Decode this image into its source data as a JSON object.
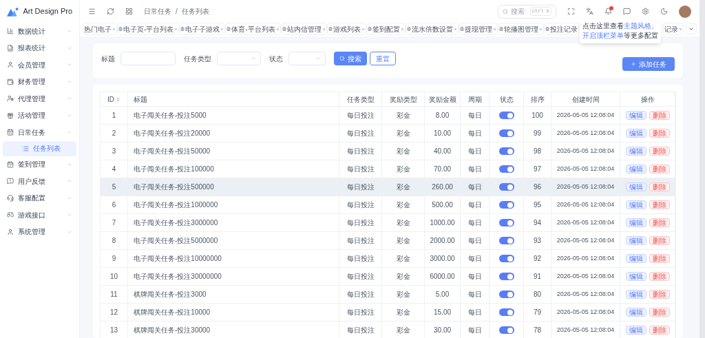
{
  "brand": {
    "name": "Art Design Pro"
  },
  "sidebar": {
    "items": [
      {
        "label": "数据统计",
        "expanded": false
      },
      {
        "label": "报表统计",
        "expanded": false
      },
      {
        "label": "会员管理",
        "expanded": false
      },
      {
        "label": "财务管理",
        "expanded": false
      },
      {
        "label": "代理管理",
        "expanded": false
      },
      {
        "label": "活动管理",
        "expanded": false
      },
      {
        "label": "日常任务",
        "expanded": true,
        "children": [
          {
            "label": "任务列表",
            "selected": true
          }
        ]
      },
      {
        "label": "签到管理",
        "expanded": false
      },
      {
        "label": "用户反馈",
        "expanded": false
      },
      {
        "label": "客服配置",
        "expanded": false
      },
      {
        "label": "游戏接口",
        "expanded": false
      },
      {
        "label": "系统管理",
        "expanded": false
      }
    ]
  },
  "breadcrumb": {
    "items": [
      "日常任务",
      "任务列表"
    ],
    "separator": "/"
  },
  "search": {
    "placeholder": "搜索",
    "shortcut": "ctrl k"
  },
  "notifications": {
    "unread": true
  },
  "tabs": [
    {
      "label": "热门电子"
    },
    {
      "label": "电子页-平台列表"
    },
    {
      "label": "电子子游戏"
    },
    {
      "label": "体育-平台列表"
    },
    {
      "label": "站内信管理"
    },
    {
      "label": "游戏列表"
    },
    {
      "label": "签到配置"
    },
    {
      "label": "流水倍数设置"
    },
    {
      "label": "提现管理"
    },
    {
      "label": "轮播图管理"
    },
    {
      "label": "投注记录"
    },
    {
      "label": "记录"
    }
  ],
  "tooltip": {
    "lines": [
      [
        {
          "text": "点击这里查看",
          "link": false
        },
        {
          "text": "主题风格",
          "link": true
        },
        {
          "text": "、",
          "link": false
        }
      ],
      [
        {
          "text": "开启顶栏菜单",
          "link": true
        },
        {
          "text": "等更多配置",
          "link": false
        }
      ]
    ]
  },
  "filters": [
    {
      "label": "标题",
      "kind": "input"
    },
    {
      "label": "任务类型",
      "kind": "select"
    },
    {
      "label": "状态",
      "kind": "select"
    }
  ],
  "search_button": "搜索",
  "reset_button": "重置",
  "add_button": "添加任务",
  "table": {
    "columns": [
      "ID",
      "标题",
      "任务类型",
      "奖励类型",
      "奖励金额",
      "周期",
      "状态",
      "排序",
      "创建时间",
      "操作"
    ],
    "rows": [
      {
        "id": "1",
        "title": "电子闯关任务-投注5000",
        "type": "每日投注",
        "reward_type": "彩金",
        "amount": "8.00",
        "period": "每日",
        "on": true,
        "sort": "100",
        "created": "2026-05-05 12:08:04",
        "hovered": false,
        "actions": [
          "编辑",
          "删除"
        ]
      },
      {
        "id": "2",
        "title": "电子闯关任务-投注20000",
        "type": "每日投注",
        "reward_type": "彩金",
        "amount": "10.00",
        "period": "每日",
        "on": true,
        "sort": "99",
        "created": "2026-05-05 12:08:04",
        "hovered": false,
        "actions": [
          "编辑",
          "删除"
        ]
      },
      {
        "id": "3",
        "title": "电子闯关任务-投注50000",
        "type": "每日投注",
        "reward_type": "彩金",
        "amount": "40.00",
        "period": "每日",
        "on": true,
        "sort": "98",
        "created": "2026-05-05 12:08:04",
        "hovered": false,
        "actions": [
          "编辑",
          "删除"
        ]
      },
      {
        "id": "4",
        "title": "电子闯关任务-投注100000",
        "type": "每日投注",
        "reward_type": "彩金",
        "amount": "70.00",
        "period": "每日",
        "on": true,
        "sort": "97",
        "created": "2026-05-05 12:08:04",
        "hovered": false,
        "actions": [
          "编辑",
          "删除"
        ]
      },
      {
        "id": "5",
        "title": "电子闯关任务-投注500000",
        "type": "每日投注",
        "reward_type": "彩金",
        "amount": "260.00",
        "period": "每日",
        "on": true,
        "sort": "96",
        "created": "2026-05-05 12:08:04",
        "hovered": true,
        "actions": [
          "编辑",
          "删除"
        ]
      },
      {
        "id": "6",
        "title": "电子闯关任务-投注1000000",
        "type": "每日投注",
        "reward_type": "彩金",
        "amount": "500.00",
        "period": "每日",
        "on": true,
        "sort": "95",
        "created": "2026-05-05 12:08:04",
        "hovered": false,
        "actions": [
          "编辑",
          "删除"
        ]
      },
      {
        "id": "7",
        "title": "电子闯关任务-投注3000000",
        "type": "每日投注",
        "reward_type": "彩金",
        "amount": "1000.00",
        "period": "每日",
        "on": true,
        "sort": "94",
        "created": "2026-05-05 12:08:04",
        "hovered": false,
        "actions": [
          "编辑",
          "删除"
        ]
      },
      {
        "id": "8",
        "title": "电子闯关任务-投注5000000",
        "type": "每日投注",
        "reward_type": "彩金",
        "amount": "2000.00",
        "period": "每日",
        "on": true,
        "sort": "93",
        "created": "2026-05-05 12:08:04",
        "hovered": false,
        "actions": [
          "编辑",
          "删除"
        ]
      },
      {
        "id": "9",
        "title": "电子闯关任务-投注10000000",
        "type": "每日投注",
        "reward_type": "彩金",
        "amount": "3000.00",
        "period": "每日",
        "on": true,
        "sort": "92",
        "created": "2026-05-05 12:08:04",
        "hovered": false,
        "actions": [
          "编辑",
          "删除"
        ]
      },
      {
        "id": "10",
        "title": "电子闯关任务-投注30000000",
        "type": "每日投注",
        "reward_type": "彩金",
        "amount": "6000.00",
        "period": "每日",
        "on": true,
        "sort": "91",
        "created": "2026-05-05 12:08:04",
        "hovered": false,
        "actions": [
          "编辑",
          "删除"
        ]
      },
      {
        "id": "11",
        "title": "棋牌闯关任务-投注3000",
        "type": "每日投注",
        "reward_type": "彩金",
        "amount": "5.00",
        "period": "每日",
        "on": true,
        "sort": "80",
        "created": "2026-05-05 12:08:04",
        "hovered": false,
        "actions": [
          "编辑",
          "删除"
        ]
      },
      {
        "id": "12",
        "title": "棋牌闯关任务-投注10000",
        "type": "每日投注",
        "reward_type": "彩金",
        "amount": "15.00",
        "period": "每日",
        "on": true,
        "sort": "79",
        "created": "2026-05-05 12:08:04",
        "hovered": false,
        "actions": [
          "编辑",
          "删除"
        ]
      },
      {
        "id": "13",
        "title": "棋牌闯关任务-投注30000",
        "type": "每日投注",
        "reward_type": "彩金",
        "amount": "30.00",
        "period": "每日",
        "on": true,
        "sort": "78",
        "created": "2026-05-05 12:08:04",
        "hovered": false,
        "actions": [
          "编辑",
          "删除"
        ]
      }
    ]
  }
}
